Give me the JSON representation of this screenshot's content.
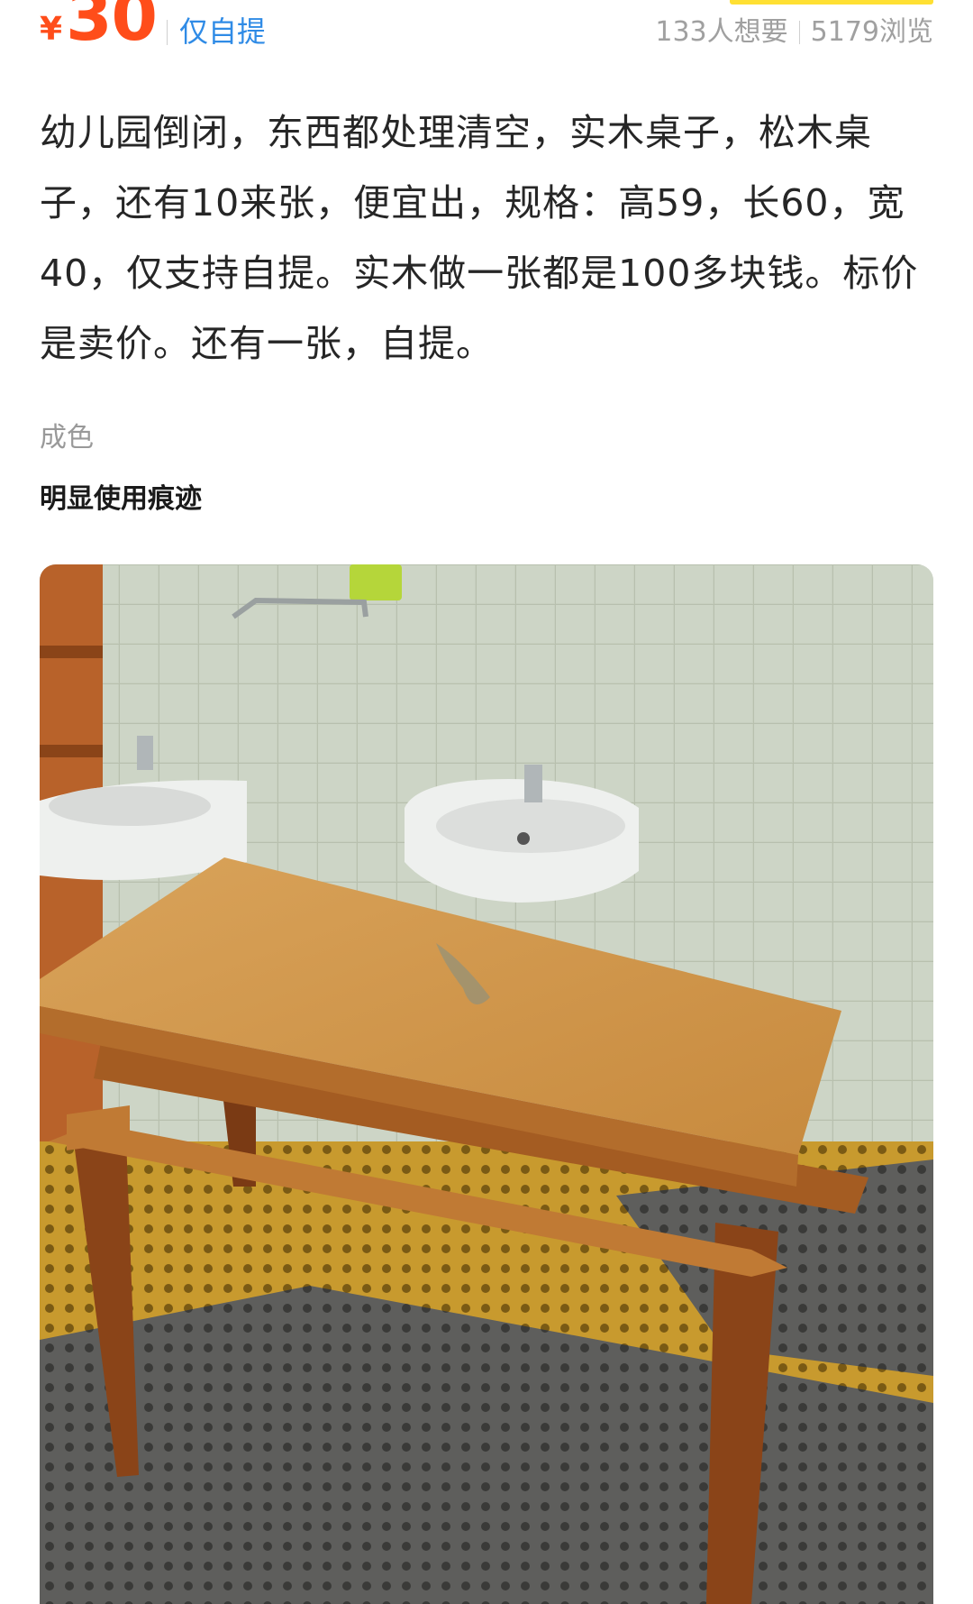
{
  "listing": {
    "currency_symbol": "¥",
    "price": "30",
    "pickup_tag": "仅自提",
    "wants": "133人想要",
    "views": "5179浏览",
    "description": "幼儿园倒闭，东西都处理清空，实木桌子，松木桌子，还有10来张，便宜出，规格：高59，长60，宽40，仅支持自提。实木做一张都是100多块钱。标价是卖价。还有一张，自提。",
    "condition_label": "成色",
    "condition_value": "明显使用痕迹"
  },
  "photo": {
    "subject": "wooden-table-photo"
  },
  "colors": {
    "price": "#ff4d1a",
    "tag": "#2f8be6",
    "accent_yellow": "#ffe033"
  }
}
